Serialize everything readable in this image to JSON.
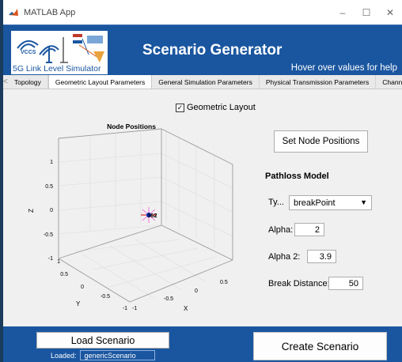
{
  "window": {
    "title": "MATLAB App",
    "controls": {
      "minimize": "–",
      "maximize": "☐",
      "close": "✕"
    }
  },
  "header": {
    "logo_text": "5G Link Level Simulator",
    "logo_badge": "VCCS",
    "title": "Scenario Generator",
    "help": "Hover over values for help"
  },
  "tabs": {
    "left_arrow": "<",
    "right_arrow": ">",
    "items": [
      {
        "label": "Topology"
      },
      {
        "label": "Geometric Layout Parameters"
      },
      {
        "label": "General Simulation Parameters"
      },
      {
        "label": "Physical Transmission Parameters"
      },
      {
        "label": "Channe"
      }
    ],
    "active_index": 1
  },
  "geometric_layout": {
    "label": "Geometric Layout",
    "checked": true,
    "check_glyph": "✓"
  },
  "plot": {
    "title": "Node Positions",
    "z_label": "Z",
    "y_label": "Y",
    "x_label": "X",
    "z_ticks": [
      "1",
      "0.5",
      "0",
      "-0.5",
      "-1"
    ],
    "y_ticks": [
      "1",
      "0.5",
      "0",
      "-0.5",
      "-1"
    ],
    "x_ticks": [
      "0.5",
      "0",
      "-0.5",
      "-1"
    ],
    "marker_label": "362"
  },
  "set_node_positions": {
    "label": "Set Node Positions"
  },
  "pathloss": {
    "title": "Pathloss Model",
    "type_label": "Ty...",
    "type_value": "breakPoint",
    "dropdown_arrow": "▼",
    "alpha_label": "Alpha:",
    "alpha_value": "2",
    "alpha2_label": "Alpha 2:",
    "alpha2_value": "3.9",
    "break_label": "Break Distance:",
    "break_value": "50"
  },
  "bottom": {
    "load_label": "Load Scenario",
    "loaded_label": "Loaded:",
    "loaded_value": "genericScenario",
    "create_label": "Create Scenario"
  },
  "colors": {
    "header_blue": "#1a56a0",
    "panel_gray": "#f0f0f0",
    "marker_blue": "#0033cc",
    "marker_red": "#dd0000",
    "marker_pink": "#ff55cc"
  }
}
